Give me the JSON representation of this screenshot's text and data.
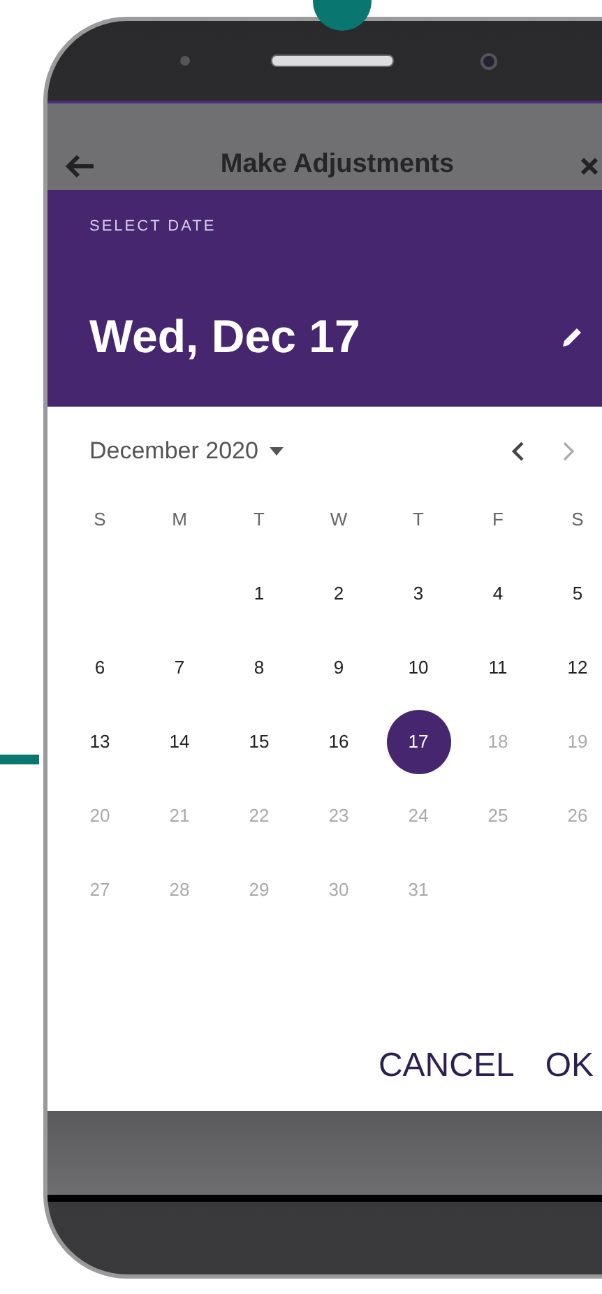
{
  "app_bar": {
    "title": "Make Adjustments"
  },
  "date_picker": {
    "heading": "SELECT DATE",
    "selected_date": "Wed, Dec 17",
    "month": "December 2020",
    "weekdays": [
      "S",
      "M",
      "T",
      "W",
      "T",
      "F",
      "S"
    ],
    "weeks": [
      [
        {
          "kind": "empty"
        },
        {
          "kind": "empty"
        },
        {
          "kind": "day",
          "label": "1",
          "selected": false,
          "disabled": false
        },
        {
          "kind": "day",
          "label": "2",
          "selected": false,
          "disabled": false
        },
        {
          "kind": "day",
          "label": "3",
          "selected": false,
          "disabled": false
        },
        {
          "kind": "day",
          "label": "4",
          "selected": false,
          "disabled": false
        },
        {
          "kind": "day",
          "label": "5",
          "selected": false,
          "disabled": false
        }
      ],
      [
        {
          "kind": "day",
          "label": "6",
          "selected": false,
          "disabled": false
        },
        {
          "kind": "day",
          "label": "7",
          "selected": false,
          "disabled": false
        },
        {
          "kind": "day",
          "label": "8",
          "selected": false,
          "disabled": false
        },
        {
          "kind": "day",
          "label": "9",
          "selected": false,
          "disabled": false
        },
        {
          "kind": "day",
          "label": "10",
          "selected": false,
          "disabled": false
        },
        {
          "kind": "day",
          "label": "11",
          "selected": false,
          "disabled": false
        },
        {
          "kind": "day",
          "label": "12",
          "selected": false,
          "disabled": false
        }
      ],
      [
        {
          "kind": "day",
          "label": "13",
          "selected": false,
          "disabled": false
        },
        {
          "kind": "day",
          "label": "14",
          "selected": false,
          "disabled": false
        },
        {
          "kind": "day",
          "label": "15",
          "selected": false,
          "disabled": false
        },
        {
          "kind": "day",
          "label": "16",
          "selected": false,
          "disabled": false
        },
        {
          "kind": "day",
          "label": "17",
          "selected": true,
          "disabled": false
        },
        {
          "kind": "day",
          "label": "18",
          "selected": false,
          "disabled": true
        },
        {
          "kind": "day",
          "label": "19",
          "selected": false,
          "disabled": true
        }
      ],
      [
        {
          "kind": "day",
          "label": "20",
          "selected": false,
          "disabled": true
        },
        {
          "kind": "day",
          "label": "21",
          "selected": false,
          "disabled": true
        },
        {
          "kind": "day",
          "label": "22",
          "selected": false,
          "disabled": true
        },
        {
          "kind": "day",
          "label": "23",
          "selected": false,
          "disabled": true
        },
        {
          "kind": "day",
          "label": "24",
          "selected": false,
          "disabled": true
        },
        {
          "kind": "day",
          "label": "25",
          "selected": false,
          "disabled": true
        },
        {
          "kind": "day",
          "label": "26",
          "selected": false,
          "disabled": true
        }
      ],
      [
        {
          "kind": "day",
          "label": "27",
          "selected": false,
          "disabled": true
        },
        {
          "kind": "day",
          "label": "28",
          "selected": false,
          "disabled": true
        },
        {
          "kind": "day",
          "label": "29",
          "selected": false,
          "disabled": true
        },
        {
          "kind": "day",
          "label": "30",
          "selected": false,
          "disabled": true
        },
        {
          "kind": "day",
          "label": "31",
          "selected": false,
          "disabled": true
        },
        {
          "kind": "empty"
        },
        {
          "kind": "empty"
        }
      ]
    ],
    "buttons": [
      "CANCEL",
      "OK"
    ]
  }
}
